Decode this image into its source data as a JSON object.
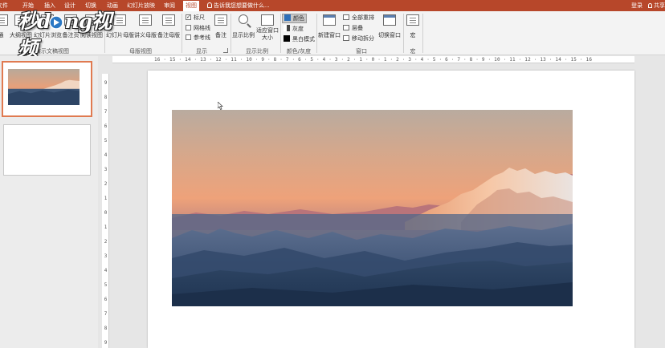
{
  "tabs": [
    {
      "label": "文件",
      "active": false
    },
    {
      "label": "开始",
      "active": false
    },
    {
      "label": "插入",
      "active": false
    },
    {
      "label": "设计",
      "active": false
    },
    {
      "label": "切换",
      "active": false
    },
    {
      "label": "动画",
      "active": false
    },
    {
      "label": "幻灯片放映",
      "active": false
    },
    {
      "label": "审阅",
      "active": false
    },
    {
      "label": "视图",
      "active": true
    }
  ],
  "tell_me": "告诉我您想要做什么...",
  "login": "登录",
  "share": "共享",
  "logo_text": "秒懂视频",
  "ribbon": {
    "presentation_views": {
      "normal": "通",
      "outline": "大纲视图",
      "sorter": "幻灯片浏览",
      "notes_page": "备注页",
      "reading": "阅读视图",
      "group": "演示文稿视图"
    },
    "master_views": {
      "slide_master": "幻灯片母版",
      "handout_master": "讲义母版",
      "notes_master": "备注母版",
      "group": "母版视图"
    },
    "show": {
      "ruler": "标尺",
      "ruler_checked": true,
      "gridlines": "网格线",
      "gridlines_checked": false,
      "guides": "参考线",
      "guides_checked": false,
      "group": "显示"
    },
    "notes": "备注",
    "zoom": {
      "zoom": "显示比例",
      "fit": "适应窗口大小",
      "group": "显示比例"
    },
    "color": {
      "color": "颜色",
      "grayscale": "灰度",
      "bw": "黑白模式",
      "group": "颜色/灰度",
      "color_swatch": "#2e6fb8",
      "gray_swatch": "#444444",
      "bw_swatch": "#000000"
    },
    "window": {
      "new_window": "新建窗口",
      "arrange_all": "全部重排",
      "cascade": "层叠",
      "move_split": "移动拆分",
      "switch_windows": "切换窗口",
      "group": "窗口"
    },
    "macros": {
      "macros": "宏",
      "group": "宏"
    }
  },
  "slides": [
    {
      "number": "1",
      "selected": true
    },
    {
      "number": "2",
      "selected": false
    }
  ],
  "h_ruler": "16 · 15 · 14 · 13 · 12 · 11 · 10 · 9 · 8 · 7 · 6 · 5 · 4 · 3 · 2 · 1 · 0 · 1 · 2 · 3 · 4 · 5 · 6 · 7 · 8 · 9 · 10 · 11 · 12 · 13 · 14 · 15 · 16",
  "v_ruler": [
    "9",
    "8",
    "7",
    "6",
    "5",
    "4",
    "3",
    "2",
    "1",
    "0",
    "1",
    "2",
    "3",
    "4",
    "5",
    "6",
    "7",
    "8",
    "9"
  ],
  "colors": {
    "accent": "#b7472a",
    "selected_thumb": "#e07a50"
  }
}
